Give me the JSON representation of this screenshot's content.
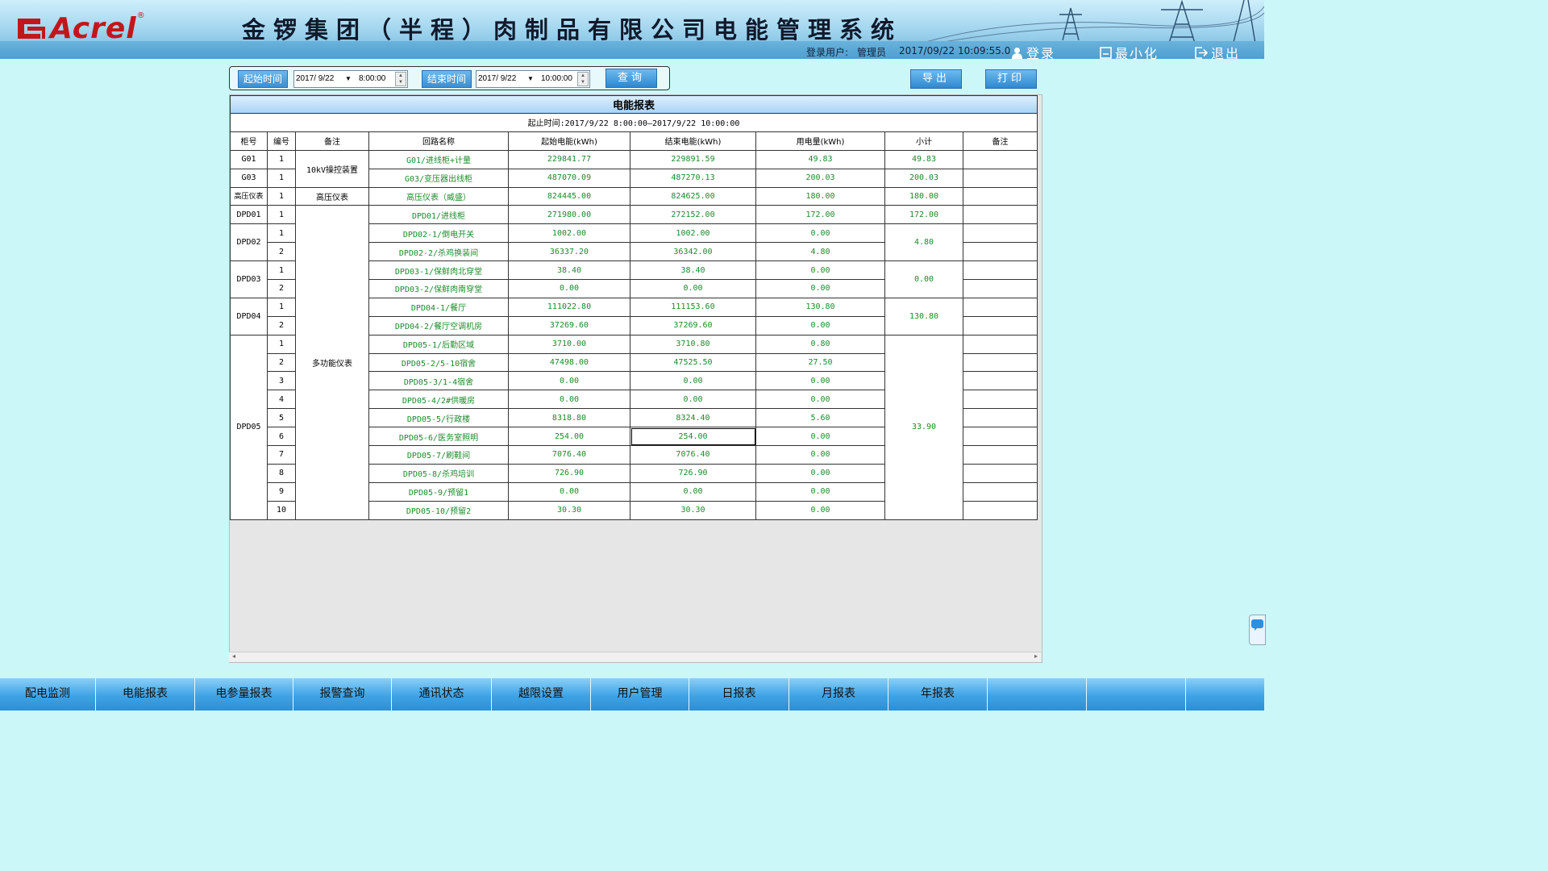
{
  "brand": {
    "logo_text": "Acrel",
    "reg": "®",
    "brand_red": "#c3161c"
  },
  "app_title": "金锣集团（半程）肉制品有限公司电能管理系统",
  "status": {
    "user_label": "登录用户:",
    "user_name": "管理员",
    "datetime": "2017/09/22   10:09:55.0",
    "login": "登录",
    "minimize": "最小化",
    "exit": "退出"
  },
  "query": {
    "start_label": "起始时间",
    "start_date": "2017/ 9/22",
    "start_time": "8:00:00",
    "end_label": "结束时间",
    "end_date": "2017/ 9/22",
    "end_time": "10:00:00",
    "search": "查询"
  },
  "actions": {
    "export": "导出",
    "print": "打印"
  },
  "report": {
    "title": "电能报表",
    "period": "起止时间:2017/9/22 8:00:00—2017/9/22 10:00:00",
    "headers": [
      "柜号",
      "编号",
      "备注",
      "回路名称",
      "起始电能(kWh)",
      "结束电能(kWh)",
      "用电量(kWh)",
      "小计",
      "备注"
    ],
    "cabinets": [
      "G01",
      "G03",
      "高压仪表",
      "DPD01",
      "DPD02",
      "DPD03",
      "DPD04",
      "DPD05"
    ],
    "remarks": [
      "10kV操控装置",
      "高压仪表",
      "多功能仪表"
    ],
    "subtotals": [
      "49.83",
      "200.03",
      "180.00",
      "172.00",
      "4.80",
      "0.00",
      "130.80",
      "33.90"
    ],
    "rows": [
      {
        "no": "1",
        "name": "G01/进线柜+计量",
        "start": "229841.77",
        "end": "229891.59",
        "usage": "49.83"
      },
      {
        "no": "1",
        "name": "G03/变压器出线柜",
        "start": "487070.09",
        "end": "487270.13",
        "usage": "200.03"
      },
      {
        "no": "1",
        "name": "高压仪表（威盛）",
        "start": "824445.00",
        "end": "824625.00",
        "usage": "180.00"
      },
      {
        "no": "1",
        "name": "DPD01/进线柜",
        "start": "271980.00",
        "end": "272152.00",
        "usage": "172.00"
      },
      {
        "no": "1",
        "name": "DPD02-1/倒电开关",
        "start": "1002.00",
        "end": "1002.00",
        "usage": "0.00"
      },
      {
        "no": "2",
        "name": "DPD02-2/杀鸡换装间",
        "start": "36337.20",
        "end": "36342.00",
        "usage": "4.80"
      },
      {
        "no": "1",
        "name": "DPD03-1/保鲜肉北穿堂",
        "start": "38.40",
        "end": "38.40",
        "usage": "0.00"
      },
      {
        "no": "2",
        "name": "DPD03-2/保鲜肉南穿堂",
        "start": "0.00",
        "end": "0.00",
        "usage": "0.00"
      },
      {
        "no": "1",
        "name": "DPD04-1/餐厅",
        "start": "111022.80",
        "end": "111153.60",
        "usage": "130.80"
      },
      {
        "no": "2",
        "name": "DPD04-2/餐厅空调机房",
        "start": "37269.60",
        "end": "37269.60",
        "usage": "0.00"
      },
      {
        "no": "1",
        "name": "DPD05-1/后勤区域",
        "start": "3710.00",
        "end": "3710.80",
        "usage": "0.80"
      },
      {
        "no": "2",
        "name": "DPD05-2/5-10宿舍",
        "start": "47498.00",
        "end": "47525.50",
        "usage": "27.50"
      },
      {
        "no": "3",
        "name": "DPD05-3/1-4宿舍",
        "start": "0.00",
        "end": "0.00",
        "usage": "0.00"
      },
      {
        "no": "4",
        "name": "DPD05-4/2#供暖房",
        "start": "0.00",
        "end": "0.00",
        "usage": "0.00"
      },
      {
        "no": "5",
        "name": "DPD05-5/行政楼",
        "start": "8318.80",
        "end": "8324.40",
        "usage": "5.60"
      },
      {
        "no": "6",
        "name": "DPD05-6/医务室照明",
        "start": "254.00",
        "end": "254.00",
        "usage": "0.00"
      },
      {
        "no": "7",
        "name": "DPD05-7/刷鞋间",
        "start": "7076.40",
        "end": "7076.40",
        "usage": "0.00"
      },
      {
        "no": "8",
        "name": "DPD05-8/杀鸡培训",
        "start": "726.90",
        "end": "726.90",
        "usage": "0.00"
      },
      {
        "no": "9",
        "name": "DPD05-9/预留1",
        "start": "0.00",
        "end": "0.00",
        "usage": "0.00"
      },
      {
        "no": "10",
        "name": "DPD05-10/预留2",
        "start": "30.30",
        "end": "30.30",
        "usage": "0.00"
      }
    ]
  },
  "nav": [
    "配电监测",
    "电能报表",
    "电参量报表",
    "报警查询",
    "通讯状态",
    "越限设置",
    "用户管理",
    "日报表",
    "月报表",
    "年报表",
    "",
    "",
    ""
  ],
  "colors": {
    "background": "#ccf7f9",
    "value_green": "#1d8a2b",
    "nav_blue": "#3ea3e6"
  }
}
